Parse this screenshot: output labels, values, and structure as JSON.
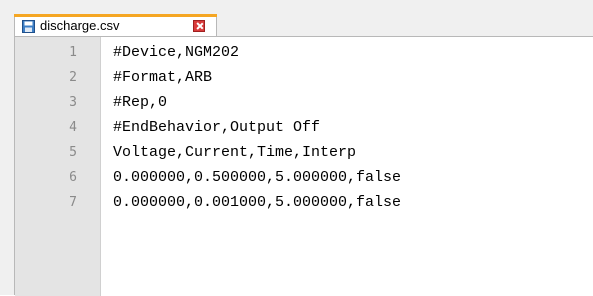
{
  "tab": {
    "file_icon": "save-disk-icon",
    "label": "discharge.csv",
    "close_icon": "close-icon",
    "accent_color": "#f5a623"
  },
  "editor": {
    "lines": [
      {
        "number": "1",
        "text": "#Device,NGM202"
      },
      {
        "number": "2",
        "text": "#Format,ARB"
      },
      {
        "number": "3",
        "text": "#Rep,0"
      },
      {
        "number": "4",
        "text": "#EndBehavior,Output Off"
      },
      {
        "number": "5",
        "text": "Voltage,Current,Time,Interp"
      },
      {
        "number": "6",
        "text": "0.000000,0.500000,5.000000,false"
      },
      {
        "number": "7",
        "text": "0.000000,0.001000,5.000000,false"
      }
    ]
  }
}
